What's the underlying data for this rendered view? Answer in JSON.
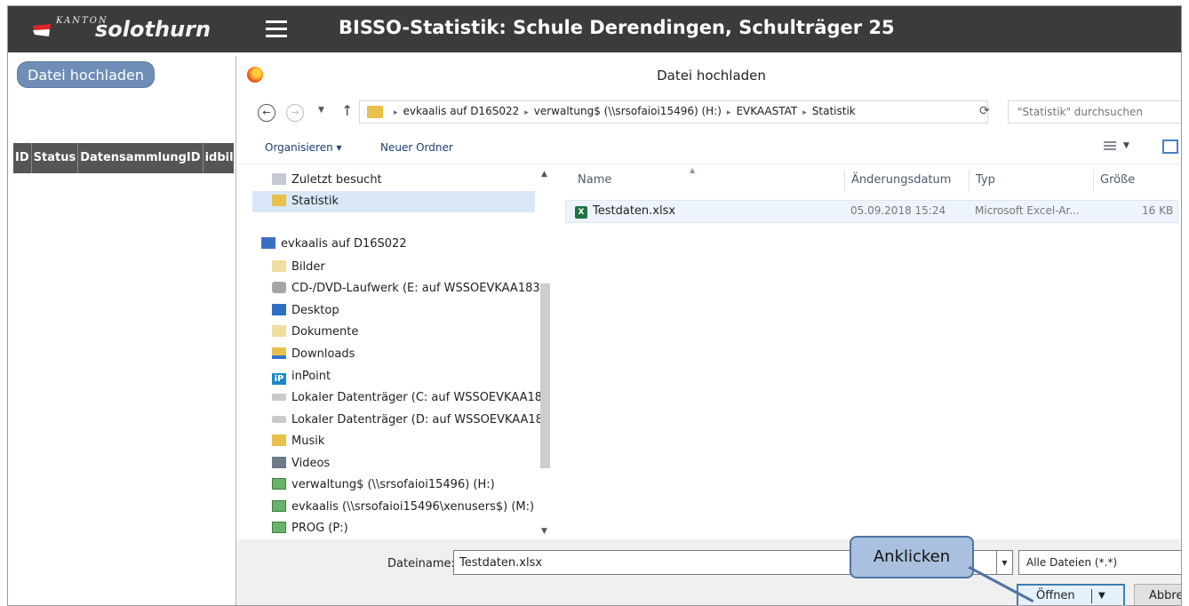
{
  "header": {
    "logo_small": "KANTON",
    "logo_name": "solothurn",
    "title": "BISSO-Statistik: Schule Derendingen, Schulträger 25"
  },
  "page": {
    "upload_button": "Datei hochladen",
    "table_columns": [
      "ID",
      "Status",
      "DatensammlungID",
      "idbildu"
    ]
  },
  "dialog": {
    "title": "Datei hochladen",
    "breadcrumbs": [
      "evkaalis auf D16S022",
      "verwaltung$ (\\\\srsofaioi15496) (H:)",
      "EVKAASTAT",
      "Statistik"
    ],
    "search_placeholder": "\"Statistik\" durchsuchen",
    "organize": "Organisieren ▾",
    "new_folder": "Neuer Ordner",
    "nav": {
      "recent": "Zuletzt besucht",
      "statistik": "Statistik",
      "computer": "evkaalis auf D16S022",
      "items": [
        "Bilder",
        "CD-/DVD-Laufwerk (E: auf WSSOEVKAA183",
        "Desktop",
        "Dokumente",
        "Downloads",
        "inPoint",
        "Lokaler Datenträger (C: auf WSSOEVKAA18",
        "Lokaler Datenträger (D: auf WSSOEVKAA18",
        "Musik",
        "Videos",
        "verwaltung$ (\\\\srsofaioi15496) (H:)",
        "evkaalis (\\\\srsofaioi15496\\xenusers$) (M:)",
        "PROG (P:)"
      ]
    },
    "columns": {
      "name": "Name",
      "date": "Änderungsdatum",
      "type": "Typ",
      "size": "Größe"
    },
    "files": [
      {
        "name": "Testdaten.xlsx",
        "date": "05.09.2018 15:24",
        "type": "Microsoft Excel-Ar...",
        "size": "16 KB"
      }
    ],
    "filename_label": "Dateiname:",
    "filename_value": "Testdaten.xlsx",
    "filetype": "Alle Dateien (*.*)",
    "open_button": "Öffnen",
    "cancel_button": "Abbrechen"
  },
  "callout": "Anklicken"
}
